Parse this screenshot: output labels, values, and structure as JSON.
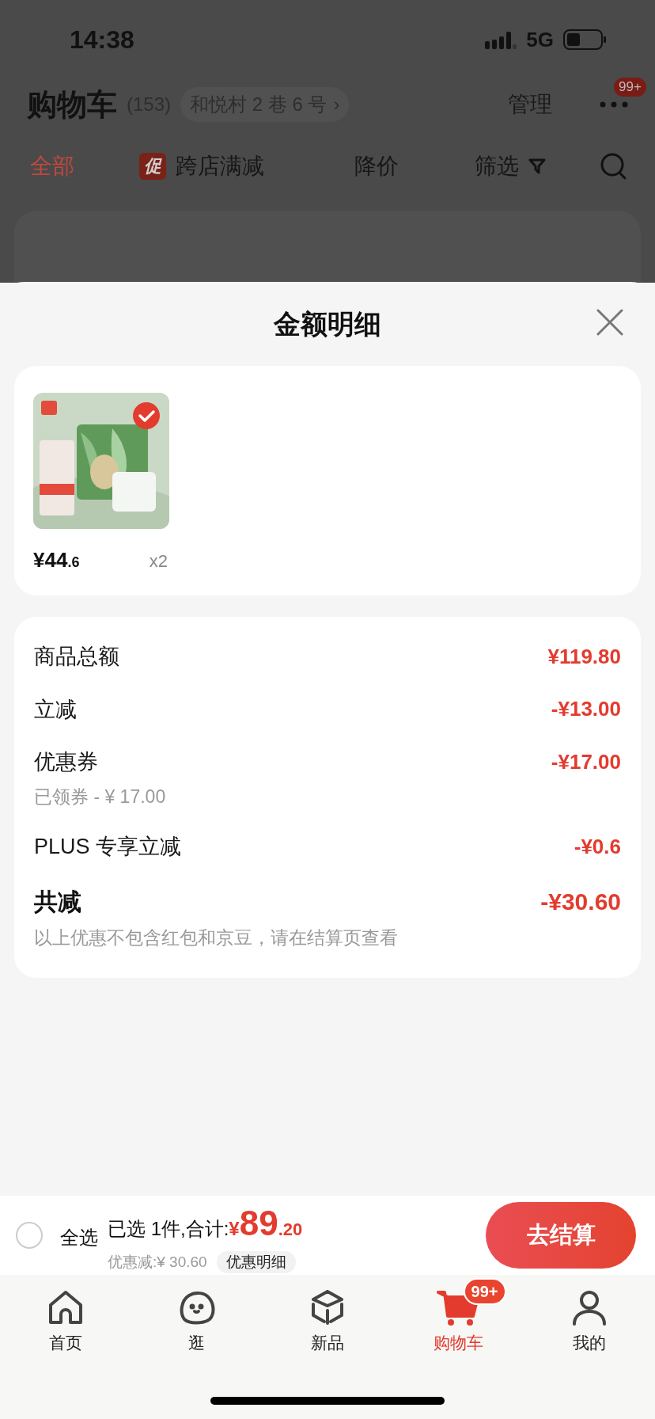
{
  "status_bar": {
    "time": "14:38",
    "network": "5G"
  },
  "header": {
    "title": "购物车",
    "count": "(153)",
    "address": "和悦村 2 巷 6 号",
    "address_arrow": "›",
    "manage": "管理",
    "more_badge": "99+"
  },
  "filter_tabs": [
    {
      "label": "全部",
      "selected": true
    },
    {
      "label": "跨店满减",
      "badge": "促",
      "selected": false
    },
    {
      "label": "降价",
      "selected": false
    },
    {
      "label": "筛选",
      "selected": false
    }
  ],
  "sheet": {
    "title": "金额明细",
    "products": [
      {
        "checked": true,
        "price_main": "¥44",
        "price_decimal": ".6",
        "quantity": "x2"
      }
    ],
    "breakdown": [
      {
        "kind": "line",
        "label": "商品总额",
        "amount": "¥119.80"
      },
      {
        "kind": "line",
        "label": "立减",
        "amount": "-¥13.00"
      },
      {
        "kind": "line",
        "label": "优惠券",
        "note": "已领券 - ¥ 17.00",
        "amount": "-¥17.00"
      },
      {
        "kind": "line",
        "label": "PLUS 专享立减",
        "amount": "-¥0.6"
      },
      {
        "kind": "total",
        "label": "共减",
        "note": "以上优惠不包含红包和京豆，请在结算页查看",
        "amount": "-¥30.60"
      }
    ]
  },
  "checkout_bar": {
    "select_all": {
      "label": "全选",
      "checked": false
    },
    "summary": "已选 1件,合计:",
    "currency": "¥",
    "total_main": "89",
    "total_decimal": ".20",
    "discount": "优惠减:¥ 30.60",
    "discount_detail": "优惠明细",
    "checkout_button": "去结算"
  },
  "bottom_nav": [
    {
      "label": "首页",
      "selected": false
    },
    {
      "label": "逛",
      "selected": false
    },
    {
      "label": "新品",
      "selected": false
    },
    {
      "label": "购物车",
      "badge": "99+",
      "selected": true
    },
    {
      "label": "我的",
      "selected": false
    }
  ]
}
